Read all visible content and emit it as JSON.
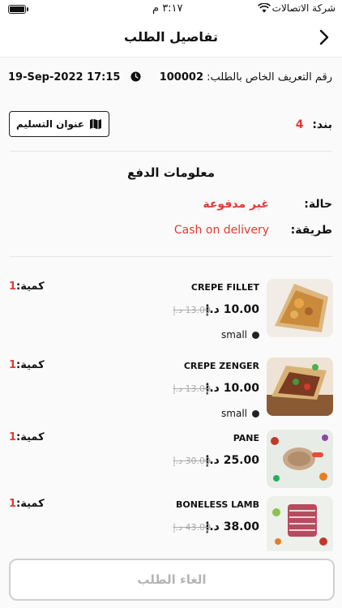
{
  "status_bar": {
    "carrier": "شركة الاتصالات",
    "time": "٣:١٧ م"
  },
  "nav": {
    "title": "تفاصيل الطلب"
  },
  "order": {
    "id_label": "رقم التعريف الخاص بالطلب:",
    "id_value": "100002",
    "date": "19-Sep-2022 17:15"
  },
  "summary": {
    "items_label": "بند:",
    "items_count": "4",
    "address_button": "عنوان التسليم"
  },
  "payment": {
    "title": "معلومات الدفع",
    "status_label": "حالة:",
    "status_value": "غير مدفوعة",
    "method_label": "طريقة:",
    "method_value": "Cash on delivery"
  },
  "products": [
    {
      "name": "CREPE FILLET",
      "price": "10.00 د.إ",
      "old_price": "13.00 د.إ",
      "size": "small",
      "qty_label": "كمية:",
      "qty": "1"
    },
    {
      "name": "CREPE ZENGER",
      "price": "10.00 د.إ",
      "old_price": "13.00 د.إ",
      "size": "small",
      "qty_label": "كمية:",
      "qty": "1"
    },
    {
      "name": "PANE",
      "price": "25.00 د.إ",
      "old_price": "30.00 د.إ",
      "size": "",
      "qty_label": "كمية:",
      "qty": "1"
    },
    {
      "name": "BONELESS LAMB",
      "price": "38.00 د.إ",
      "old_price": "43.00 د.إ",
      "size": "",
      "qty_label": "كمية:",
      "qty": "1"
    }
  ],
  "actions": {
    "cancel_order": "الغاء الطلب"
  },
  "colors": {
    "accent": "#e53935",
    "muted": "#aaaaaa"
  },
  "icons": [
    "battery-icon",
    "wifi-icon",
    "back-chevron-icon",
    "clock-icon",
    "map-icon",
    "size-dot-icon"
  ]
}
